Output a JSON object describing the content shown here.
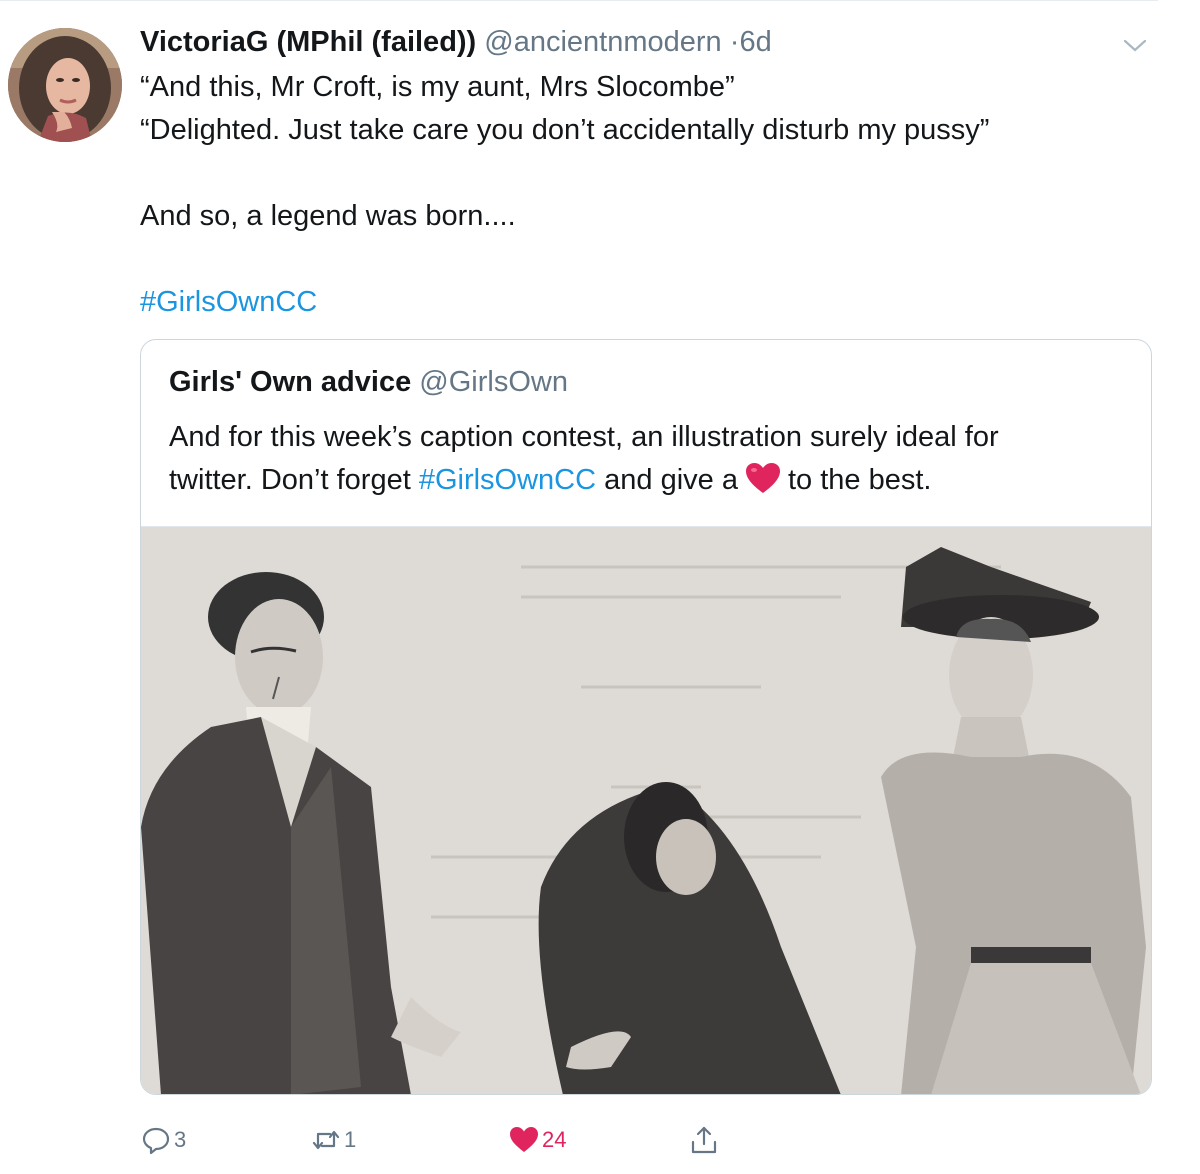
{
  "tweet": {
    "author_name": "VictoriaG (MPhil (failed))",
    "author_handle": "@ancientnmodern",
    "separator": "·",
    "time": "6d",
    "lines": [
      "“And this, Mr Croft, is my aunt, Mrs Slocombe”",
      "“Delighted. Just take care you don’t accidentally disturb my pussy”",
      "",
      "And so, a legend was born....",
      ""
    ],
    "hashtag": "#GirlsOwnCC"
  },
  "quoted_tweet": {
    "author_name": "Girls' Own advice",
    "author_handle": "@GirlsOwn",
    "line1": "And for this week’s caption contest, an illustration surely ideal for",
    "line2_before": "twitter. Don’t forget ",
    "line2_hashtag": "#GirlsOwnCC",
    "line2_mid": " and give a",
    "line2_after": "to the best.",
    "image_icon": "vintage-illustration-image"
  },
  "actions": {
    "reply_count": "3",
    "retweet_count": "1",
    "like_count": "24",
    "share_icon": "share-icon"
  },
  "colors": {
    "link": "#1b95e0",
    "secondary_text": "#657786",
    "like": "#e0245e",
    "border": "#ccd6dd"
  }
}
